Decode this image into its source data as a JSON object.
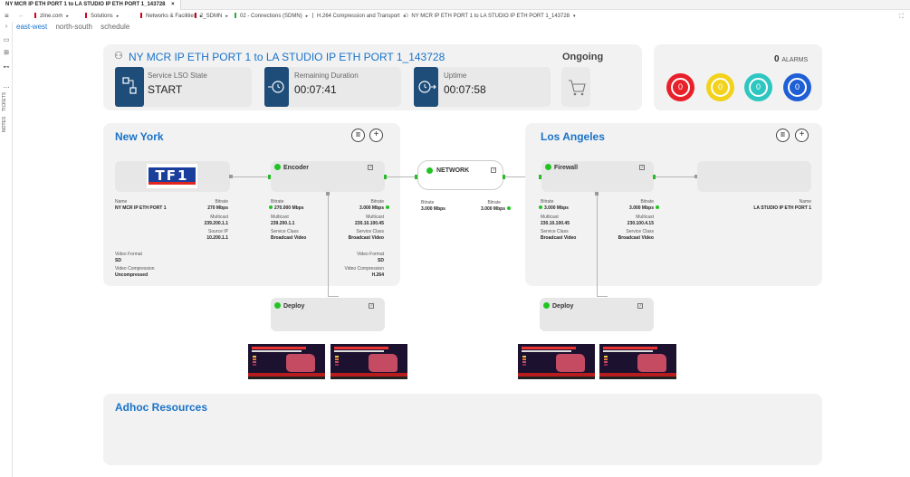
{
  "tab": {
    "title": "NY MCR IP ETH PORT 1 to LA STUDIO IP ETH PORT 1_143728",
    "close": "×"
  },
  "breadcrumbs": [
    {
      "label": "zline.com",
      "flag": "red"
    },
    {
      "label": "Solutions",
      "flag": "red"
    },
    {
      "label": "Networks & Facilities",
      "flag": "red"
    },
    {
      "label": "2_SDMN",
      "flag": "red"
    },
    {
      "label": "02 - Connections (SDMN)",
      "flag": "green"
    },
    {
      "label": "H.264 Compression and Transport",
      "flag": "none"
    },
    {
      "label": "NY MCR IP ETH PORT 1 to LA STUDIO IP ETH PORT 1_143728",
      "flag": "icon"
    }
  ],
  "rail": {
    "notes": "NOTES",
    "tickets": "TICKETS"
  },
  "subnav": {
    "tabs": [
      "east-west",
      "north-south",
      "schedule"
    ],
    "active": 0
  },
  "header": {
    "title": "NY MCR IP ETH PORT 1 to LA STUDIO  IP ETH PORT 1_143728",
    "status": "Ongoing",
    "cards": [
      {
        "label": "Service LSO State",
        "value": "START",
        "icon": "workflow-icon"
      },
      {
        "label": "Remaining Duration",
        "value": "00:07:41",
        "icon": "timer-icon"
      },
      {
        "label": "Uptime",
        "value": "00:07:58",
        "icon": "uptime-icon"
      }
    ]
  },
  "alarms": {
    "count": "0",
    "label": "ALARMS",
    "items": [
      {
        "value": "0",
        "color": "#e8202a"
      },
      {
        "value": "0",
        "color": "#f2d21b"
      },
      {
        "value": "0",
        "color": "#2ec6c1"
      },
      {
        "value": "0",
        "color": "#1f5fd6"
      }
    ]
  },
  "ny": {
    "title": "New York",
    "logo": "TF1",
    "name_label": "Name",
    "name_value": "NY MCR IP ETH PORT 1",
    "bitrate_label": "Bitrate",
    "bitrate_value": "270 Mbps",
    "multicast_label": "Multicast",
    "multicast_value": "239.200.1.1",
    "source_label": "Source IP",
    "source_value": "10.200.1.1",
    "vformat_label": "Video Format",
    "vformat_value": "SD",
    "vcomp_label": "Video Compression",
    "vcomp_value": "Uncompressed",
    "encoder": {
      "title": "Encoder",
      "in_bitrate_label": "Bitrate",
      "in_bitrate_value": "270.000 Mbps",
      "in_multicast_label": "Multicast",
      "in_multicast_value": "239.200.1.1",
      "in_class_label": "Service Class",
      "in_class_value": "Broadcast Video",
      "out_bitrate_label": "Bitrate",
      "out_bitrate_value": "3.000 Mbps",
      "out_multicast_label": "Multicast",
      "out_multicast_value": "230.10.100.45",
      "out_class_label": "Service Class",
      "out_class_value": "Broadcast Video",
      "out_vformat_label": "Video Format",
      "out_vformat_value": "SD",
      "out_vcomp_label": "Video Compression",
      "out_vcomp_value": "H.264"
    },
    "deploy": "Deploy"
  },
  "network": {
    "title": "NETWORK",
    "in_bitrate_label": "Bitrate",
    "in_bitrate_value": "3.000 Mbps",
    "out_bitrate_label": "Bitrate",
    "out_bitrate_value": "3.000 Mbps"
  },
  "la": {
    "title": "Los Angeles",
    "firewall": {
      "title": "Firewall",
      "in_bitrate_label": "Bitrate",
      "in_bitrate_value": "3.000 Mbps",
      "in_multicast_label": "Multicast",
      "in_multicast_value": "230.10.100.45",
      "in_class_label": "Service Class",
      "in_class_value": "Broadcast Video",
      "out_bitrate_label": "Bitrate",
      "out_bitrate_value": "3.000 Mbps",
      "out_multicast_label": "Multicast",
      "out_multicast_value": "230.100.4.15",
      "out_class_label": "Service Class",
      "out_class_value": "Broadcast Video"
    },
    "name_label": "Name",
    "name_value": "LA STUDIO  IP ETH PORT 1",
    "deploy": "Deploy"
  },
  "adhoc": {
    "title": "Adhoc Resources"
  },
  "colors": {
    "accent": "#1a73c8",
    "status_ok": "#21c421",
    "dark_icon": "#1f4d7a"
  }
}
